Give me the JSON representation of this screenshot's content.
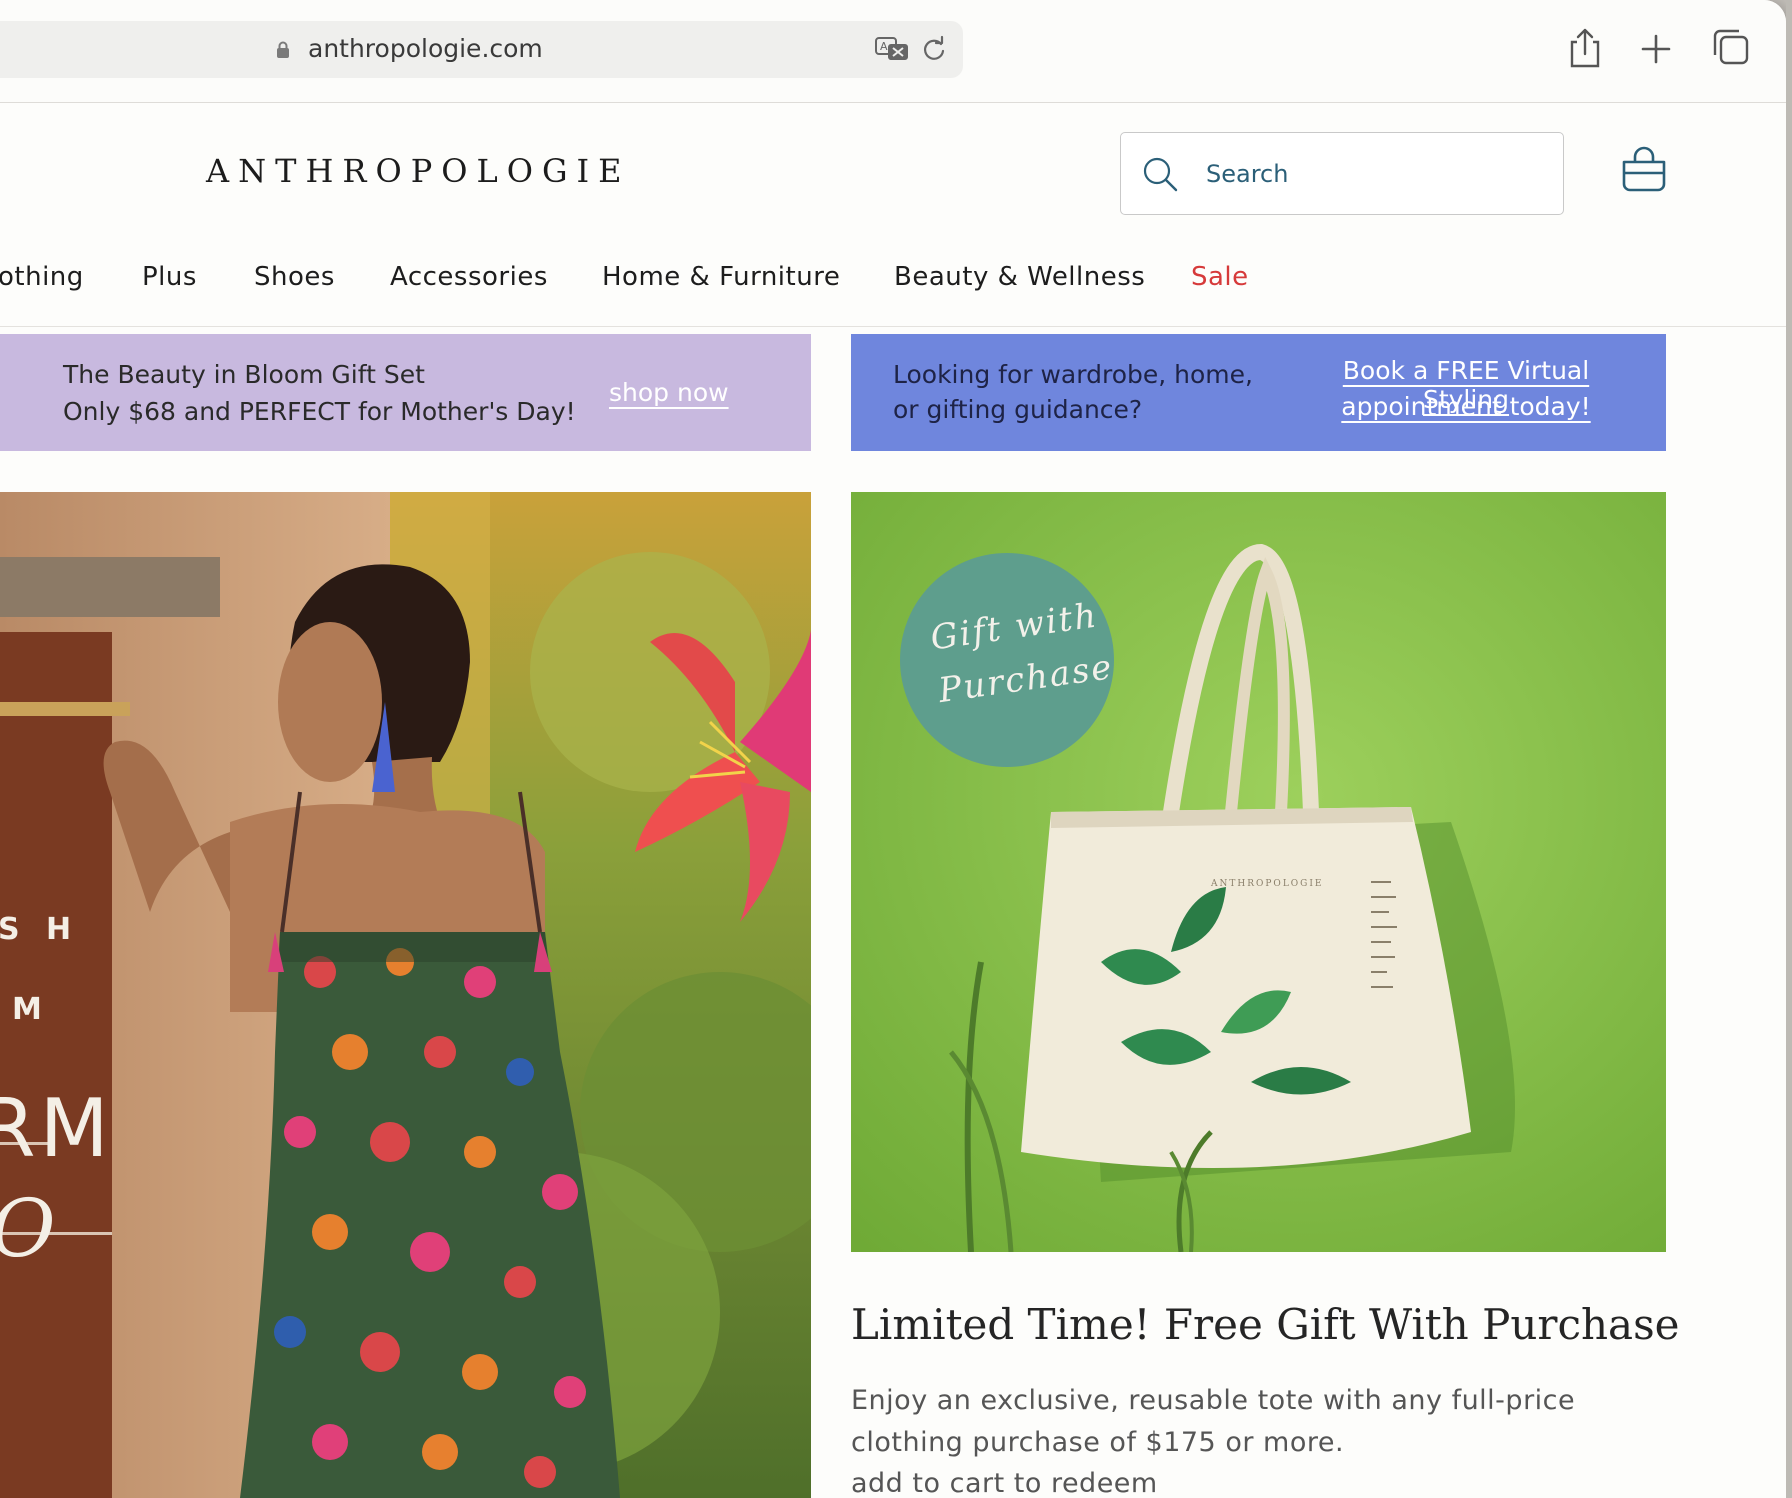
{
  "browser": {
    "url": "anthropologie.com"
  },
  "header": {
    "logo": "ANTHROPOLOGIE",
    "search_placeholder": "Search"
  },
  "nav": {
    "items": [
      "othing",
      "Plus",
      "Shoes",
      "Accessories",
      "Home & Furniture",
      "Beauty & Wellness",
      "Sale"
    ]
  },
  "banners": {
    "left": {
      "line1": "The Beauty in Bloom Gift Set",
      "line2": "Only $68 and PERFECT for Mother's Day!",
      "cta": "shop now"
    },
    "right": {
      "line1": "Looking for wardrobe, home,",
      "line2": "or gifting guidance?",
      "cta_line1": "Book a FREE Virtual Styling",
      "cta_line2": "appointment today!"
    }
  },
  "hero_left": {
    "sign_lines": [
      "S H",
      "M",
      "RM",
      "O"
    ]
  },
  "hero_right": {
    "badge_line1": "Gift with",
    "badge_line2": "Purchase",
    "tote_print": "ANTHROPOLOGIE"
  },
  "promo": {
    "title": "Limited Time! Free Gift With Purchase",
    "line1": "Enjoy an exclusive, reusable tote with any full-price",
    "line2": "clothing purchase of $175 or more.",
    "line3": "add to cart to redeem"
  },
  "colors": {
    "sale": "#d63a3a",
    "banner_left_bg": "#c8b9df",
    "banner_right_bg": "#6f86dd",
    "badge_bg": "#5e9e8d",
    "promo_green": "#86bf4b"
  }
}
